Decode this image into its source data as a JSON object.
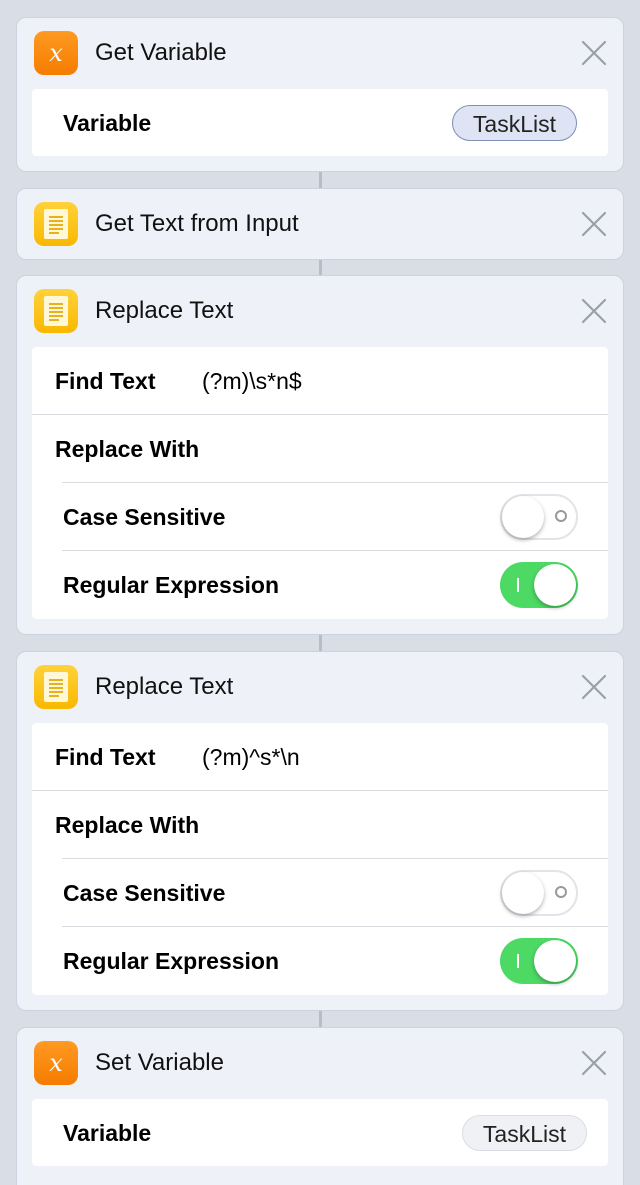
{
  "workflow": {
    "get_variable": {
      "icon": "x-variable-icon",
      "title": "Get Variable",
      "variable_label": "Variable",
      "variable_value": "TaskList"
    },
    "get_text": {
      "icon": "text-document-icon",
      "title": "Get Text from Input"
    },
    "replace_1": {
      "icon": "text-document-icon",
      "title": "Replace Text",
      "find_label": "Find Text",
      "find_value": "(?m)\\s*n$",
      "replace_label": "Replace With",
      "replace_value": "",
      "case_label": "Case Sensitive",
      "case_on": false,
      "regex_label": "Regular Expression",
      "regex_on": true
    },
    "replace_2": {
      "icon": "text-document-icon",
      "title": "Replace Text",
      "find_label": "Find Text",
      "find_value": "(?m)^s*\\n",
      "replace_label": "Replace With",
      "replace_value": "",
      "case_label": "Case Sensitive",
      "case_on": false,
      "regex_label": "Regular Expression",
      "regex_on": true
    },
    "set_variable": {
      "icon": "x-variable-icon",
      "title": "Set Variable",
      "variable_label": "Variable",
      "variable_value": "TaskList"
    }
  },
  "colors": {
    "background": "#d8dde6",
    "variable_icon": "#f57c00",
    "text_icon": "#f8b800",
    "toggle_on": "#4cd964"
  }
}
